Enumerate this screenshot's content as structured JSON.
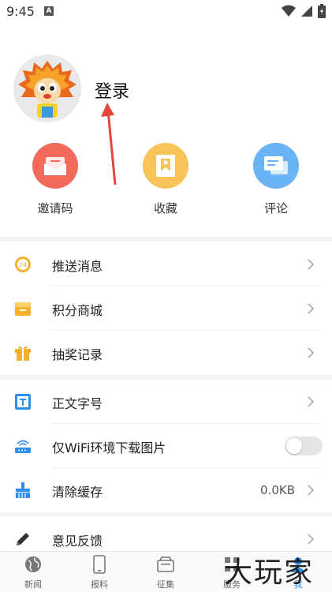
{
  "status_bar": {
    "time": "9:45",
    "indicator": "A"
  },
  "profile": {
    "login_label": "登录"
  },
  "quick_actions": [
    {
      "label": "邀请码",
      "icon": "envelope-icon",
      "color": "#f26a5a"
    },
    {
      "label": "收藏",
      "icon": "bookmark-icon",
      "color": "#f8c45a"
    },
    {
      "label": "评论",
      "icon": "comment-icon",
      "color": "#6ab4f5"
    }
  ],
  "menu_group_1": [
    {
      "label": "推送消息",
      "icon": "push-notification-icon"
    },
    {
      "label": "积分商城",
      "icon": "points-mall-icon"
    },
    {
      "label": "抽奖记录",
      "icon": "gift-icon"
    }
  ],
  "menu_group_2": [
    {
      "label": "正文字号",
      "icon": "font-size-icon"
    },
    {
      "label": "仅WiFi环境下载图片",
      "icon": "wifi-router-icon",
      "toggle_on": false
    },
    {
      "label": "清除缓存",
      "icon": "broom-icon",
      "value": "0.0KB"
    }
  ],
  "menu_group_3": [
    {
      "label": "意见反馈",
      "icon": "pencil-icon"
    }
  ],
  "bottom_nav": [
    {
      "label": "新闻",
      "icon": "globe-icon"
    },
    {
      "label": "报料",
      "icon": "phone-icon"
    },
    {
      "label": "征集",
      "icon": "folder-icon"
    },
    {
      "label": "服务",
      "icon": "grid-icon"
    },
    {
      "label": "我",
      "icon": "user-icon",
      "active": true
    }
  ],
  "watermark": "大玩家",
  "colors": {
    "accent": "#2f8ff0",
    "arrow": "#e8453c"
  }
}
